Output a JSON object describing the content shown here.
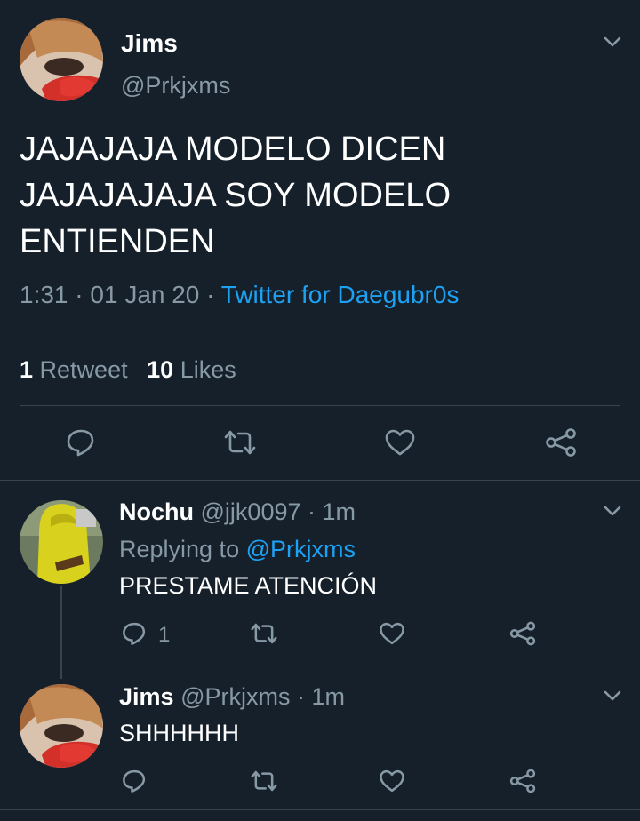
{
  "main_tweet": {
    "author_name": "Jims",
    "author_handle": "@Prkjxms",
    "text_lines": [
      "JAJAJAJA MODELO DICEN",
      "JAJAJAJAJA SOY MODELO",
      "ENTIENDEN"
    ],
    "time": "1:31",
    "dot1": "·",
    "date": "01 Jan 20",
    "dot2": "·",
    "source": "Twitter for Daegubr0s",
    "retweets_count": "1",
    "retweets_label": "Retweet",
    "likes_count": "10",
    "likes_label": "Likes"
  },
  "replies": [
    {
      "author_name": "Nochu",
      "meta": "@jjk0097 · 1m",
      "replying_prefix": "Replying to",
      "replying_to": "@Prkjxms",
      "text": "PRESTAME ATENCIÓN",
      "reply_count": "1"
    },
    {
      "author_name": "Jims",
      "meta": "@Prkjxms · 1m",
      "text": "SHHHHHH"
    }
  ],
  "colors": {
    "background": "#15202b",
    "text": "#ffffff",
    "muted": "#8899a6",
    "link": "#1da1f2",
    "divider": "#38444d"
  },
  "icons": [
    "chevron-down-icon",
    "reply-icon",
    "retweet-icon",
    "like-icon",
    "share-icon"
  ]
}
